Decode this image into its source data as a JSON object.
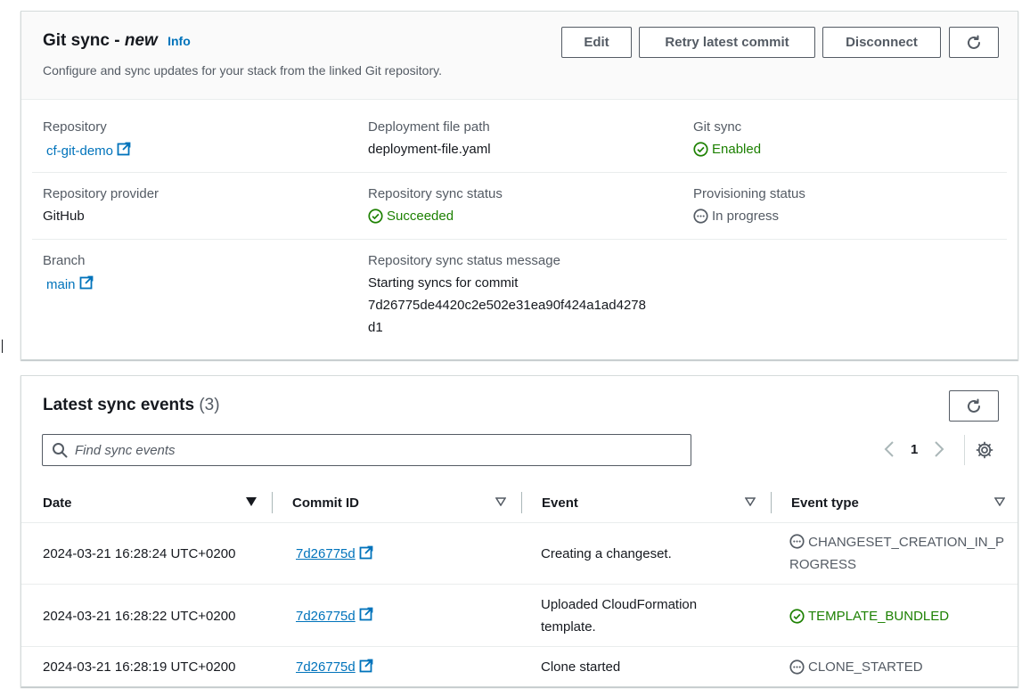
{
  "git_sync_panel": {
    "title_prefix": "Git sync - ",
    "title_new": "new",
    "info": "Info",
    "subtitle": "Configure and sync updates for your stack from the linked Git repository.",
    "buttons": {
      "edit": "Edit",
      "retry": "Retry latest commit",
      "disconnect": "Disconnect"
    },
    "fields": {
      "repository": {
        "label": "Repository",
        "value": "cf-git-demo"
      },
      "deployment_file_path": {
        "label": "Deployment file path",
        "value": "deployment-file.yaml"
      },
      "git_sync": {
        "label": "Git sync",
        "value": "Enabled"
      },
      "repository_provider": {
        "label": "Repository provider",
        "value": "GitHub"
      },
      "repository_sync_status": {
        "label": "Repository sync status",
        "value": "Succeeded"
      },
      "provisioning_status": {
        "label": "Provisioning status",
        "value": "In progress"
      },
      "branch": {
        "label": "Branch",
        "value": "main"
      },
      "sync_status_message": {
        "label": "Repository sync status message",
        "line1": "Starting syncs for commit",
        "line2": "7d26775de4420c2e502e31ea90f424a1ad4278",
        "line3": "d1"
      }
    }
  },
  "events_panel": {
    "title": "Latest sync events",
    "count": "(3)",
    "search_placeholder": "Find sync events",
    "page": "1",
    "columns": [
      "Date",
      "Commit ID",
      "Event",
      "Event type"
    ],
    "rows": [
      {
        "date": "2024-03-21 16:28:24 UTC+0200",
        "commit": "7d26775d",
        "event": "Creating a changeset.",
        "event_type_1": "CHANGESET_CREATION_IN_P",
        "event_type_2": "ROGRESS",
        "status": "in-progress"
      },
      {
        "date": "2024-03-21 16:28:22 UTC+0200",
        "commit": "7d26775d",
        "event_1": "Uploaded CloudFormation",
        "event_2": "template.",
        "event_type": "TEMPLATE_BUNDLED",
        "status": "success"
      },
      {
        "date": "2024-03-21 16:28:19 UTC+0200",
        "commit": "7d26775d",
        "event": "Clone started",
        "event_type": "CLONE_STARTED",
        "status": "in-progress"
      }
    ]
  },
  "colors": {
    "link": "#0073bb",
    "success": "#1d8102",
    "muted": "#545b64",
    "text": "#16191f"
  }
}
